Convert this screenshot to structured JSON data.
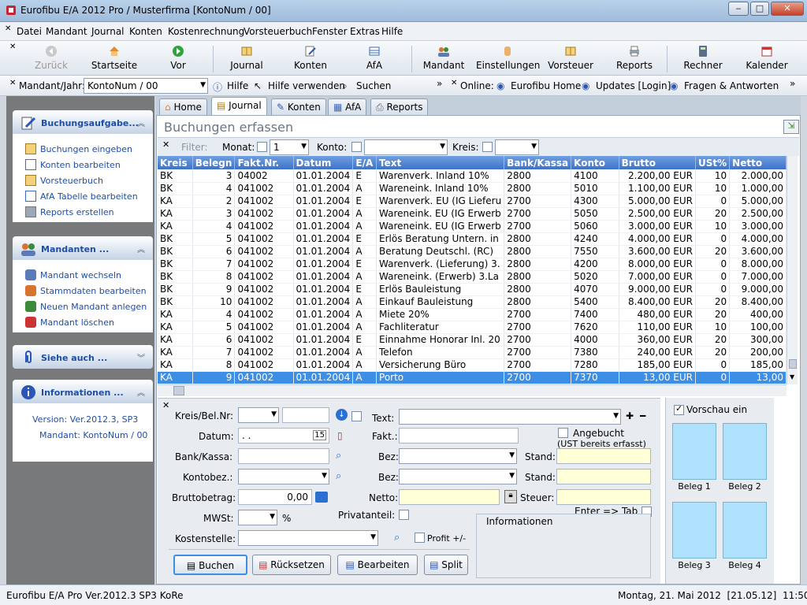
{
  "window": {
    "title": "Eurofibu E/A 2012 Pro / Musterfirma [KontoNum / 00]"
  },
  "menu": [
    "Datei",
    "Mandant",
    "Journal",
    "Konten",
    "Kostenrechnung",
    "Vorsteuerbuch",
    "Fenster",
    "Extras",
    "Hilfe"
  ],
  "toolbar": {
    "back": "Zurück",
    "home": "Startseite",
    "forward": "Vor",
    "journal": "Journal",
    "konten": "Konten",
    "afa": "AfA",
    "mandant": "Mandant",
    "einstellungen": "Einstellungen",
    "vorsteuer": "Vorsteuer",
    "reports": "Reports",
    "rechner": "Rechner",
    "kalender": "Kalender"
  },
  "bar2": {
    "mandant_label": "Mandant/Jahr:",
    "mandant_value": "KontoNum / 00",
    "hilfe": "Hilfe",
    "hilfe_verwenden": "Hilfe verwenden",
    "suchen": "Suchen",
    "online_label": "Online:",
    "eurofibu_home": "Eurofibu Home",
    "updates": "Updates [Login]",
    "fragen": "Fragen & Antworten"
  },
  "sidebar": {
    "buchungsaufgaben": {
      "title": "Buchungsaufgabe...",
      "items": [
        "Buchungen eingeben",
        "Konten bearbeiten",
        "Vorsteuerbuch",
        "AfA Tabelle bearbeiten",
        "Reports erstellen"
      ]
    },
    "mandanten": {
      "title": "Mandanten ...",
      "items": [
        "Mandant wechseln",
        "Stammdaten bearbeiten",
        "Neuen Mandant anlegen",
        "Mandant löschen"
      ]
    },
    "siehe_auch": {
      "title": "Siehe auch ..."
    },
    "informationen": {
      "title": "Informationen ...",
      "version": "Version: Ver.2012.3, SP3",
      "mandant": "Mandant: KontoNum / 00"
    }
  },
  "tabs": [
    "Home",
    "Journal",
    "Konten",
    "AfA",
    "Reports"
  ],
  "journal": {
    "heading": "Buchungen erfassen",
    "filter": {
      "label": "Filter:",
      "monat_label": "Monat:",
      "monat_value": "1",
      "konto_label": "Konto:",
      "kreis_label": "Kreis:"
    },
    "columns": [
      "Kreis",
      "Belegn",
      "Fakt.Nr.",
      "Datum",
      "E/A",
      "Text",
      "Bank/Kassa",
      "Konto",
      "Brutto",
      "USt%",
      "Netto"
    ],
    "rows": [
      [
        "BK",
        "3",
        "04002",
        "01.01.2004",
        "E",
        "Warenverk. Inland 10%",
        "2800",
        "4100",
        "2.200,00 EUR",
        "10",
        "2.000,00"
      ],
      [
        "BK",
        "4",
        "041002",
        "01.01.2004",
        "A",
        "Wareneink. Inland 10%",
        "2800",
        "5010",
        "1.100,00 EUR",
        "10",
        "1.000,00"
      ],
      [
        "KA",
        "2",
        "041002",
        "01.01.2004",
        "E",
        "Warenverk. EU (IG Lieferu",
        "2700",
        "4300",
        "5.000,00 EUR",
        "0",
        "5.000,00"
      ],
      [
        "KA",
        "3",
        "041002",
        "01.01.2004",
        "A",
        "Wareneink. EU (IG Erwerb",
        "2700",
        "5050",
        "2.500,00 EUR",
        "20",
        "2.500,00"
      ],
      [
        "KA",
        "4",
        "041002",
        "01.01.2004",
        "A",
        "Wareneink. EU (IG Erwerb",
        "2700",
        "5060",
        "3.000,00 EUR",
        "10",
        "3.000,00"
      ],
      [
        "BK",
        "5",
        "041002",
        "01.01.2004",
        "E",
        "Erlös Beratung Untern. in",
        "2800",
        "4240",
        "4.000,00 EUR",
        "0",
        "4.000,00"
      ],
      [
        "BK",
        "6",
        "041002",
        "01.01.2004",
        "A",
        "Beratung Deutschl. (RC)",
        "2800",
        "7550",
        "3.600,00 EUR",
        "20",
        "3.600,00"
      ],
      [
        "BK",
        "7",
        "041002",
        "01.01.2004",
        "E",
        "Warenverk. (Lieferung) 3.",
        "2800",
        "4200",
        "8.000,00 EUR",
        "0",
        "8.000,00"
      ],
      [
        "BK",
        "8",
        "041002",
        "01.01.2004",
        "A",
        "Wareneink. (Erwerb) 3.La",
        "2800",
        "5020",
        "7.000,00 EUR",
        "0",
        "7.000,00"
      ],
      [
        "BK",
        "9",
        "041002",
        "01.01.2004",
        "E",
        "Erlös Bauleistung",
        "2800",
        "4070",
        "9.000,00 EUR",
        "0",
        "9.000,00"
      ],
      [
        "BK",
        "10",
        "041002",
        "01.01.2004",
        "A",
        "Einkauf Bauleistung",
        "2800",
        "5400",
        "8.400,00 EUR",
        "20",
        "8.400,00"
      ],
      [
        "KA",
        "4",
        "041002",
        "01.01.2004",
        "A",
        "Miete 20%",
        "2700",
        "7400",
        "480,00 EUR",
        "20",
        "400,00"
      ],
      [
        "KA",
        "5",
        "041002",
        "01.01.2004",
        "A",
        "Fachliteratur",
        "2700",
        "7620",
        "110,00 EUR",
        "10",
        "100,00"
      ],
      [
        "KA",
        "6",
        "041002",
        "01.01.2004",
        "E",
        "Einnahme Honorar Inl. 20",
        "2700",
        "4000",
        "360,00 EUR",
        "20",
        "300,00"
      ],
      [
        "KA",
        "7",
        "041002",
        "01.01.2004",
        "A",
        "Telefon",
        "2700",
        "7380",
        "240,00 EUR",
        "20",
        "200,00"
      ],
      [
        "KA",
        "8",
        "041002",
        "01.01.2004",
        "A",
        "Versicherung Büro",
        "2700",
        "7280",
        "185,00 EUR",
        "0",
        "185,00"
      ],
      [
        "KA",
        "9",
        "041002",
        "01.01.2004",
        "A",
        "Porto",
        "2700",
        "7370",
        "13,00 EUR",
        "0",
        "13,00"
      ]
    ]
  },
  "form": {
    "kreis_label": "Kreis/Bel.Nr:",
    "text_label": "Text:",
    "datum_label": "Datum:",
    "datum_value": " .  .",
    "fakt_label": "Fakt.:",
    "angebucht_label": "Angebucht",
    "ust_note": "(UST bereits erfasst)",
    "bank_label": "Bank/Kassa:",
    "bez_label": "Bez:",
    "stand_label": "Stand:",
    "kontobez_label": "Kontobez.:",
    "brutto_label": "Bruttobetrag:",
    "brutto_value": "0,00",
    "netto_label": "Netto:",
    "steuer_label": "Steuer:",
    "mwst_label": "MWSt:",
    "percent": "%",
    "privatanteil_label": "Privatanteil:",
    "enter_tab_label": "Enter => Tab",
    "kostenstelle_label": "Kostenstelle:",
    "profit_label": "Profit +/-",
    "informationen_label": "Informationen",
    "buchen": "Buchen",
    "ruecksetzen": "Rücksetzen",
    "bearbeiten": "Bearbeiten",
    "split": "Split"
  },
  "preview": {
    "label": "Vorschau ein",
    "belege": [
      "Beleg 1",
      "Beleg 2",
      "Beleg 3",
      "Beleg 4"
    ]
  },
  "status": {
    "left": "Eurofibu E/A Pro Ver.2012.3 SP3 KoRe",
    "right": "Montag, 21. Mai 2012  [21.05.12]  11:50"
  },
  "colors": {
    "header_blue": "#3d72c9",
    "selection_blue": "#3d8fe5",
    "sidebar_gray": "#78797b",
    "link_blue": "#1f4ea5"
  }
}
